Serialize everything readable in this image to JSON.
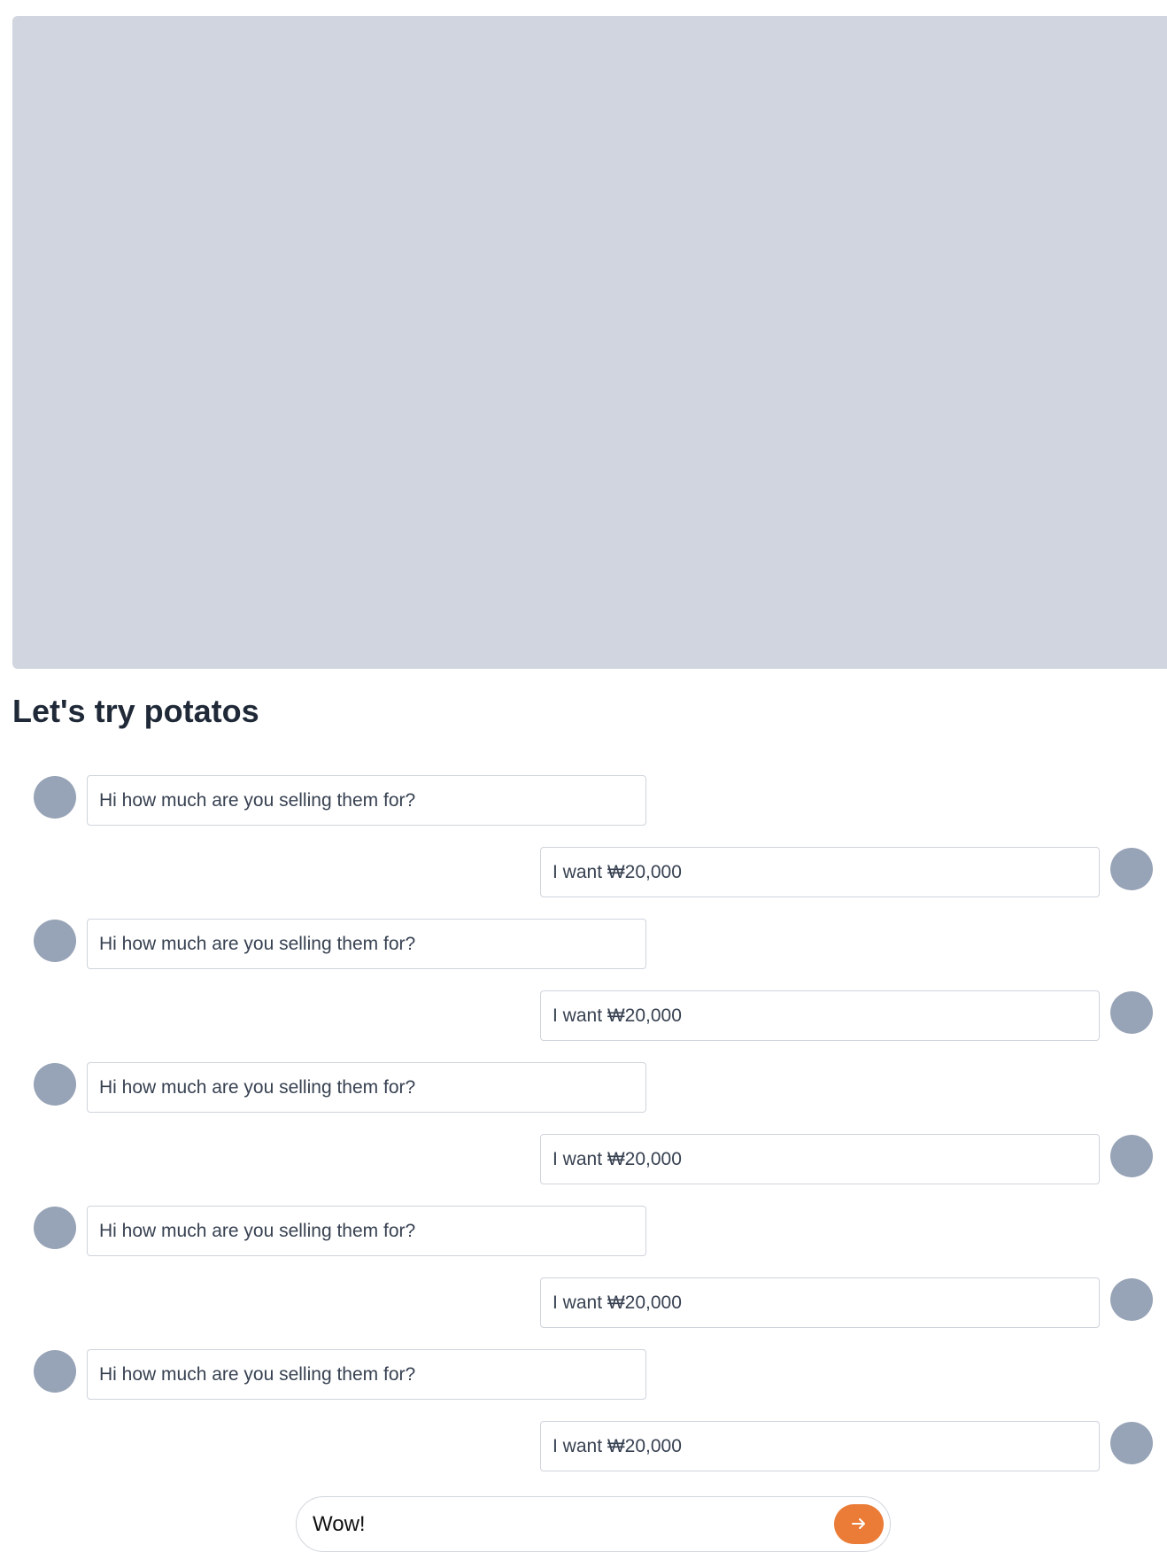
{
  "title": "Let's try potatos",
  "messages": [
    {
      "side": "in",
      "text": "Hi how much are you selling them for?"
    },
    {
      "side": "out",
      "text": "I want ₩20,000"
    },
    {
      "side": "in",
      "text": "Hi how much are you selling them for?"
    },
    {
      "side": "out",
      "text": "I want ₩20,000"
    },
    {
      "side": "in",
      "text": "Hi how much are you selling them for?"
    },
    {
      "side": "out",
      "text": "I want ₩20,000"
    },
    {
      "side": "in",
      "text": "Hi how much are you selling them for?"
    },
    {
      "side": "out",
      "text": "I want ₩20,000"
    },
    {
      "side": "in",
      "text": "Hi how much are you selling them for?"
    },
    {
      "side": "out",
      "text": "I want ₩20,000"
    }
  ],
  "composer": {
    "value": "Wow!",
    "send_icon": "arrow-right-icon"
  },
  "colors": {
    "hero_placeholder": "#d0d5df",
    "avatar": "#97a3b6",
    "send_button": "#ea7c37"
  }
}
